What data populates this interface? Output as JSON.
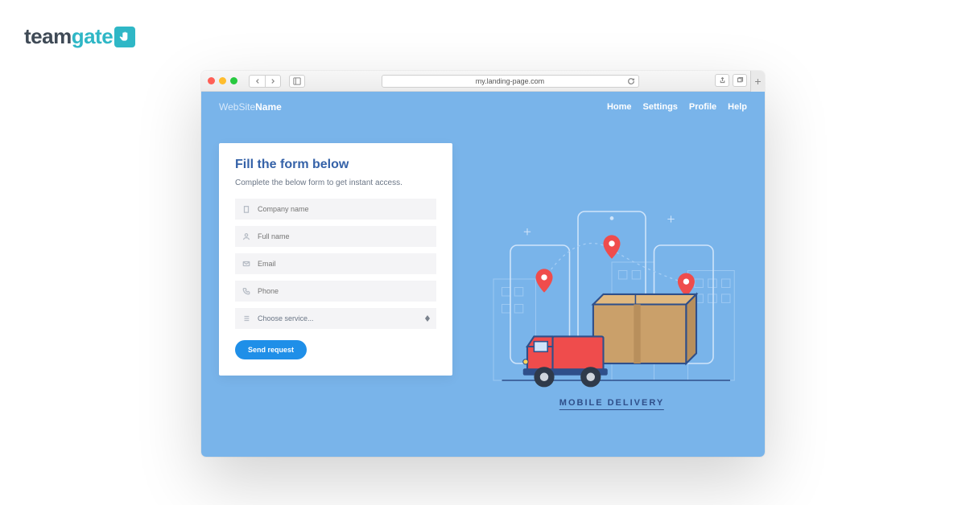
{
  "brand": {
    "part1": "team",
    "part2": "gate"
  },
  "chrome": {
    "url": "my.landing-page.com"
  },
  "site": {
    "name_part1": "WebSite",
    "name_part2": "Name",
    "nav": {
      "home": "Home",
      "settings": "Settings",
      "profile": "Profile",
      "help": "Help"
    }
  },
  "form": {
    "title": "Fill the form below",
    "subtitle": "Complete the below form to get instant access.",
    "company_placeholder": "Company name",
    "fullname_placeholder": "Full name",
    "email_placeholder": "Email",
    "phone_placeholder": "Phone",
    "service_placeholder": "Choose service...",
    "submit_label": "Send request"
  },
  "illustration": {
    "caption": "MOBILE DELIVERY"
  }
}
